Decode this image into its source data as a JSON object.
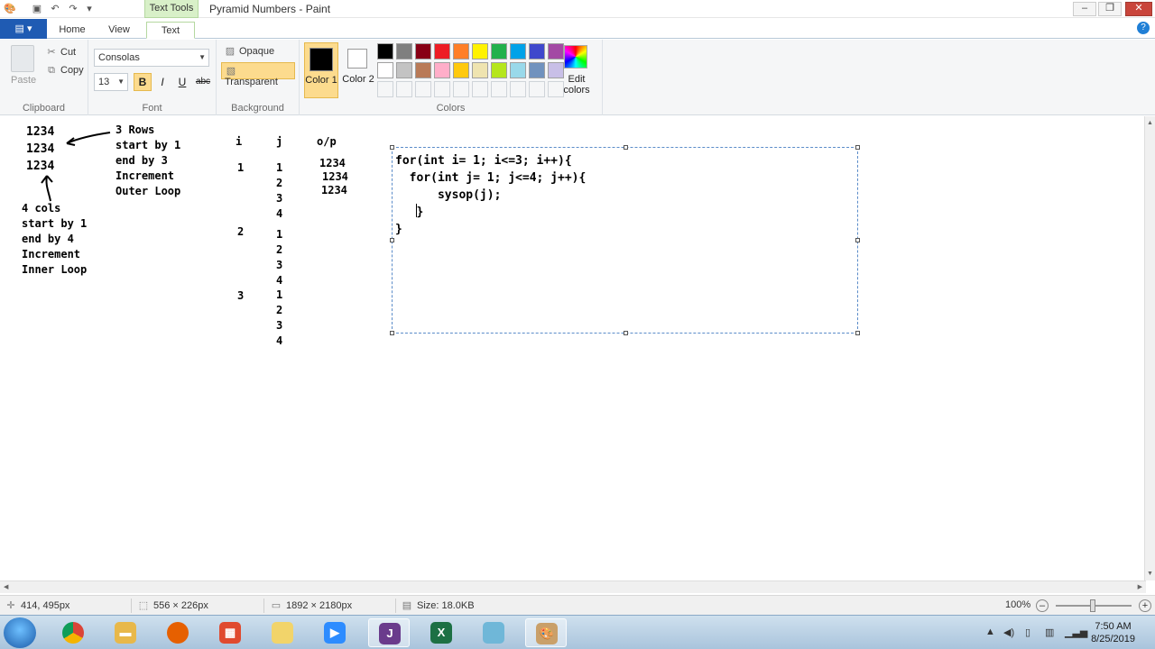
{
  "titlebar": {
    "title": "Pyramid Numbers - Paint",
    "contextual_tab": "Text Tools",
    "minimize": "–",
    "maximize": "❐",
    "close": "✕"
  },
  "tabs": {
    "file": "▤ ▾",
    "home": "Home",
    "view": "View",
    "text": "Text",
    "help": "?"
  },
  "ribbon": {
    "clipboard": {
      "label": "Clipboard",
      "paste": "Paste",
      "cut": "Cut",
      "copy": "Copy"
    },
    "font": {
      "label": "Font",
      "family": "Consolas",
      "size": "13",
      "bold": "B",
      "italic": "I",
      "underline": "U",
      "strike": "abc"
    },
    "background": {
      "label": "Background",
      "opaque": "Opaque",
      "transparent": "Transparent"
    },
    "colors": {
      "label": "Colors",
      "color1": "Color 1",
      "color1_value": "#000000",
      "color2": "Color 2",
      "color2_value": "#ffffff",
      "edit_colors": "Edit colors",
      "palette_row1": [
        "#000000",
        "#7f7f7f",
        "#880015",
        "#ed1c24",
        "#ff7f27",
        "#fff200",
        "#22b14c",
        "#00a2e8",
        "#3f48cc",
        "#a349a4"
      ],
      "palette_row2": [
        "#ffffff",
        "#c3c3c3",
        "#b97a57",
        "#ffaec9",
        "#ffc90e",
        "#efe4b0",
        "#b5e61d",
        "#99d9ea",
        "#7092be",
        "#c8bfe7"
      ]
    }
  },
  "canvas": {
    "numbers": [
      "1234",
      "1234",
      "1234"
    ],
    "rows_note": "3 Rows\nstart by 1\nend by 3\nIncrement\nOuter Loop",
    "cols_note": "4 cols\nstart by 1\nend by 4\nIncrement\nInner Loop",
    "table": {
      "headers": [
        "i",
        "j",
        "o/p"
      ],
      "i_values": [
        "1",
        "2",
        "3"
      ],
      "j_values": [
        "1",
        "2",
        "3",
        "4",
        "1",
        "2",
        "3",
        "4",
        "1",
        "2",
        "3",
        "4"
      ],
      "op_values": [
        "1234",
        "1234",
        "1234"
      ]
    },
    "code": "for(int i= 1; i<=3; i++){\n  for(int j= 1; j<=4; j++){\n      sysop(j);\n   }\n}"
  },
  "statusbar": {
    "cursor": "414, 495px",
    "selection": "556 × 226px",
    "image_size": "1892 × 2180px",
    "file_size": "Size: 18.0KB",
    "zoom": "100%"
  },
  "taskbar": {
    "time": "7:50 AM",
    "date": "8/25/2019"
  }
}
